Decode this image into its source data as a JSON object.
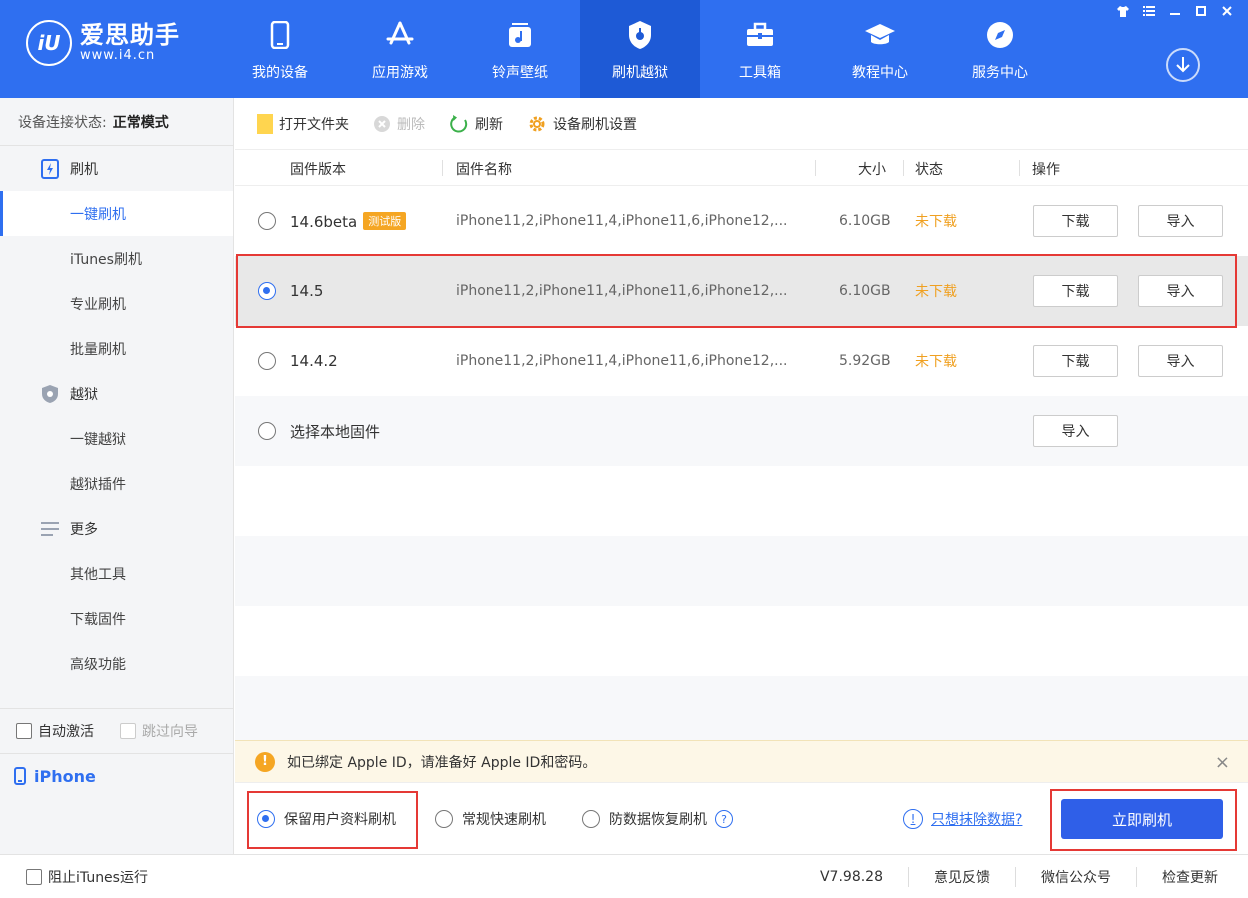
{
  "app": {
    "name": "爱思助手",
    "url": "www.i4.cn",
    "logo_mark": "iU"
  },
  "nav": [
    {
      "label": "我的设备",
      "icon": "phone-icon"
    },
    {
      "label": "应用游戏",
      "icon": "app-store-icon"
    },
    {
      "label": "铃声壁纸",
      "icon": "music-icon"
    },
    {
      "label": "刷机越狱",
      "icon": "shield-icon",
      "active": true
    },
    {
      "label": "工具箱",
      "icon": "toolbox-icon"
    },
    {
      "label": "教程中心",
      "icon": "graduation-cap-icon"
    },
    {
      "label": "服务中心",
      "icon": "compass-icon"
    }
  ],
  "window_controls": [
    "shirt-icon",
    "menu-icon",
    "minimize-icon",
    "maximize-icon",
    "close-icon"
  ],
  "sidebar": {
    "status_label": "设备连接状态:",
    "status_value": "正常模式",
    "groups": [
      {
        "label": "刷机",
        "items": [
          "一键刷机",
          "iTunes刷机",
          "专业刷机",
          "批量刷机"
        ]
      },
      {
        "label": "越狱",
        "items": [
          "一键越狱",
          "越狱插件"
        ]
      },
      {
        "label": "更多",
        "items": [
          "其他工具",
          "下载固件",
          "高级功能"
        ]
      }
    ],
    "auto_activate": "自动激活",
    "skip_guide": "跳过向导",
    "device": "iPhone"
  },
  "toolbar": {
    "open_folder": "打开文件夹",
    "delete": "删除",
    "refresh": "刷新",
    "settings": "设备刷机设置"
  },
  "table": {
    "headers": {
      "version": "固件版本",
      "name": "固件名称",
      "size": "大小",
      "status": "状态",
      "action": "操作"
    },
    "rows": [
      {
        "version": "14.6beta",
        "badge": "测试版",
        "name": "iPhone11,2,iPhone11,4,iPhone11,6,iPhone12,...",
        "size": "6.10GB",
        "status": "未下载",
        "download": "下载",
        "import": "导入"
      },
      {
        "version": "14.5",
        "badge": "",
        "name": "iPhone11,2,iPhone11,4,iPhone11,6,iPhone12,...",
        "size": "6.10GB",
        "status": "未下载",
        "download": "下载",
        "import": "导入",
        "selected": true
      },
      {
        "version": "14.4.2",
        "badge": "",
        "name": "iPhone11,2,iPhone11,4,iPhone11,6,iPhone12,...",
        "size": "5.92GB",
        "status": "未下载",
        "download": "下载",
        "import": "导入"
      }
    ],
    "local": {
      "label": "选择本地固件",
      "import": "导入"
    }
  },
  "notice": {
    "text": "如已绑定 Apple ID，请准备好 Apple ID和密码。",
    "close": "×"
  },
  "options": {
    "keep_data": "保留用户资料刷机",
    "quick": "常规快速刷机",
    "anti_recovery": "防数据恢复刷机",
    "help": "?",
    "erase_link": "只想抹除数据?",
    "flash_button": "立即刷机"
  },
  "footer": {
    "block_itunes": "阻止iTunes运行",
    "version": "V7.98.28",
    "feedback": "意见反馈",
    "wechat": "微信公众号",
    "check_update": "检查更新"
  },
  "colors": {
    "brand": "#2f6ff0",
    "warning": "#f5a623",
    "highlight": "#e53935"
  }
}
